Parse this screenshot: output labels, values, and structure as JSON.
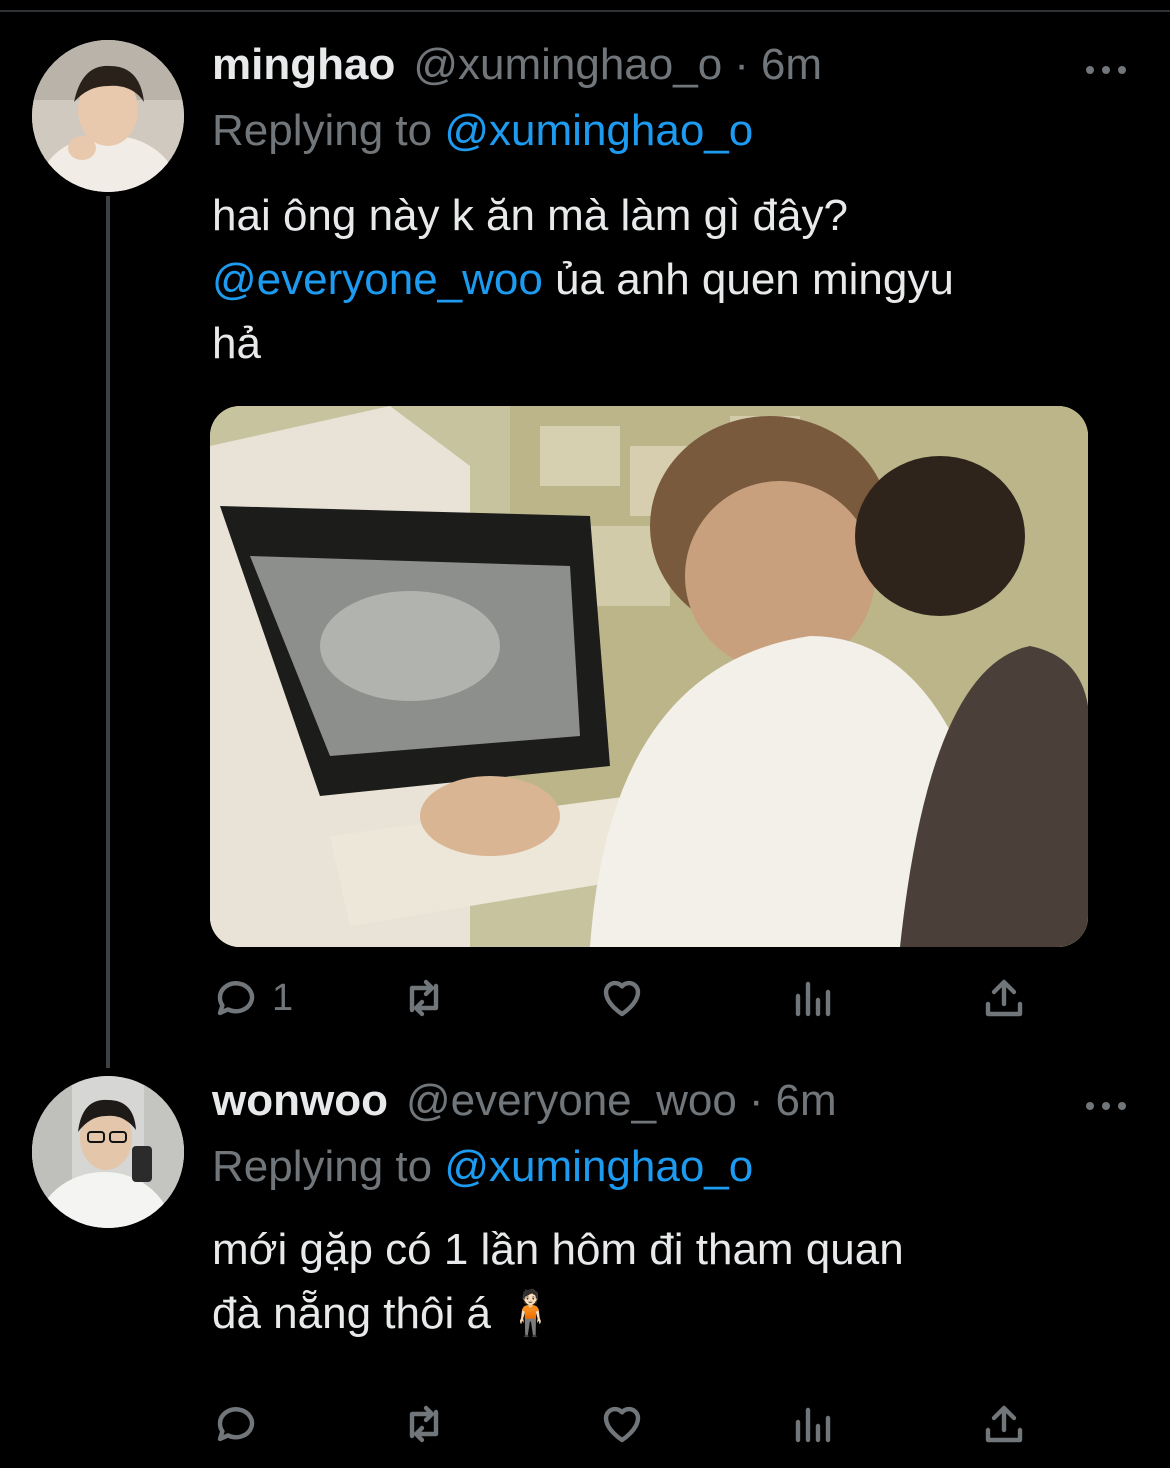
{
  "colors": {
    "background": "#000000",
    "text": "#e7e9ea",
    "muted": "#71767b",
    "accent": "#1d9bf0"
  },
  "tweets": [
    {
      "name": "minghao",
      "handle": "@xuminghao_o",
      "separator": "·",
      "time": "6m",
      "replying_prefix": "Replying to",
      "replying_to": "@xuminghao_o",
      "text_line1": "hai ông này k ăn mà làm gì đây?",
      "text_mention": "@everyone_woo",
      "text_line2_rest": " ủa anh quen mingyu",
      "text_line3": "hả",
      "has_media": true,
      "actions": {
        "reply_count": "1",
        "retweet_count": "",
        "like_count": ""
      }
    },
    {
      "name": "wonwoo",
      "handle": "@everyone_woo",
      "separator": "·",
      "time": "6m",
      "replying_prefix": "Replying to",
      "replying_to": "@xuminghao_o",
      "text_line1": "mới gặp có 1 lần hôm đi tham quan",
      "text_line2": "đà nẵng thôi á 🧍🏻",
      "has_media": false,
      "actions": {
        "reply_count": "",
        "retweet_count": "",
        "like_count": ""
      }
    }
  ],
  "icons": [
    "reply-icon",
    "retweet-icon",
    "like-icon",
    "analytics-icon",
    "share-icon",
    "more-icon"
  ]
}
